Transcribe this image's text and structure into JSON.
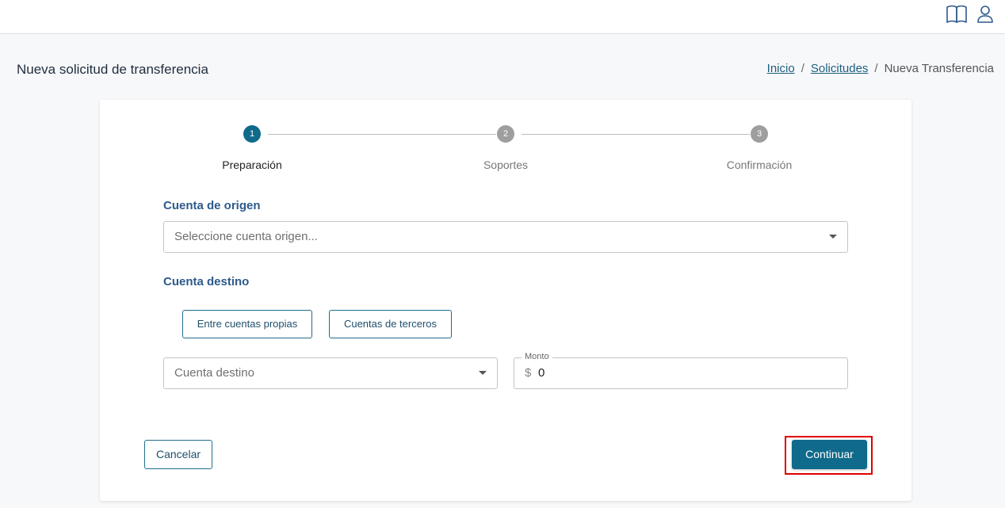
{
  "header": {
    "icons": [
      "book-icon",
      "user-icon"
    ]
  },
  "page": {
    "title": "Nueva solicitud de transferencia"
  },
  "breadcrumb": {
    "items": [
      {
        "label": "Inicio",
        "link": true
      },
      {
        "label": "Solicitudes",
        "link": true
      },
      {
        "label": "Nueva Transferencia",
        "link": false
      }
    ],
    "separator": "/"
  },
  "stepper": {
    "steps": [
      {
        "number": "1",
        "label": "Preparación",
        "active": true
      },
      {
        "number": "2",
        "label": "Soportes",
        "active": false
      },
      {
        "number": "3",
        "label": "Confirmación",
        "active": false
      }
    ]
  },
  "form": {
    "origin": {
      "label": "Cuenta de origen",
      "placeholder": "Seleccione cuenta origen..."
    },
    "destination": {
      "label": "Cuenta destino",
      "own_accounts_button": "Entre cuentas propias",
      "third_party_button": "Cuentas de terceros",
      "placeholder": "Cuenta destino"
    },
    "amount": {
      "label": "Monto",
      "currency_symbol": "$",
      "value": "0"
    }
  },
  "actions": {
    "cancel_label": "Cancelar",
    "continue_label": "Continuar"
  },
  "colors": {
    "primary": "#0f6a8b",
    "active_step": "#0f6a8b",
    "inactive_step": "#9e9e9e",
    "section_label": "#2d5a8c",
    "highlight": "#e00000"
  }
}
